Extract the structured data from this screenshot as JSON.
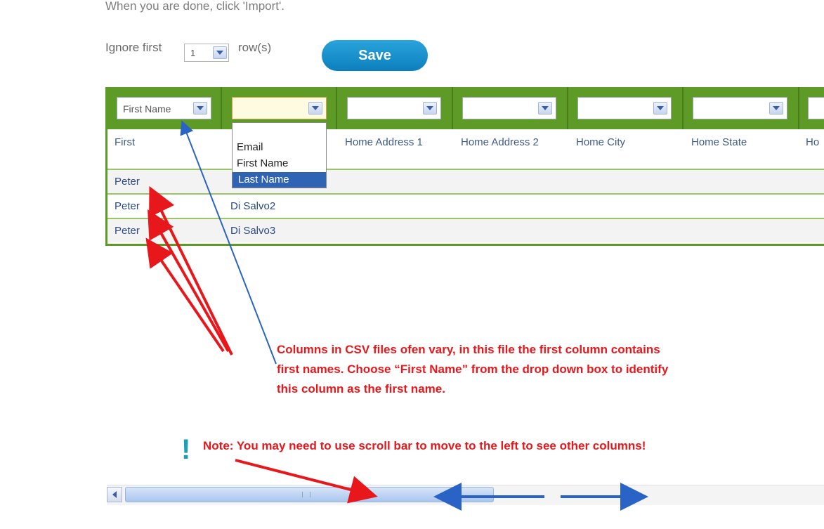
{
  "instructions": {
    "top_text": "When you are done, click 'Import'."
  },
  "ignore_rows": {
    "label_before": "Ignore first",
    "value": "1",
    "label_after": "row(s)"
  },
  "save_button": {
    "label": "Save"
  },
  "columns": [
    {
      "selected": "First Name",
      "header": "First"
    },
    {
      "selected": "",
      "header": ""
    },
    {
      "selected": "",
      "header": "Home Address 1"
    },
    {
      "selected": "",
      "header": "Home Address 2"
    },
    {
      "selected": "",
      "header": "Home City"
    },
    {
      "selected": "",
      "header": "Home State"
    },
    {
      "selected": "",
      "header": "Ho"
    }
  ],
  "rows": [
    [
      "Peter",
      ""
    ],
    [
      "Peter",
      "Di Salvo2"
    ],
    [
      "Peter",
      "Di Salvo3"
    ]
  ],
  "dropdown_options": [
    "Email",
    "First Name",
    "Last Name"
  ],
  "dropdown_highlighted": "Last Name",
  "annotation": {
    "line1": "Columns in CSV files ofen vary, in this file the first column contains",
    "line2": "first names. Choose “First Name” from the drop down box to identify",
    "line3": "this column as the first name."
  },
  "note": {
    "mark": "!",
    "text": "Note: You may need to use scroll bar to move to the left to see other columns!"
  },
  "colors": {
    "grid_header": "#5d9a26",
    "annotation": "#e8171b",
    "arrow_blue": "#2a63c6"
  }
}
